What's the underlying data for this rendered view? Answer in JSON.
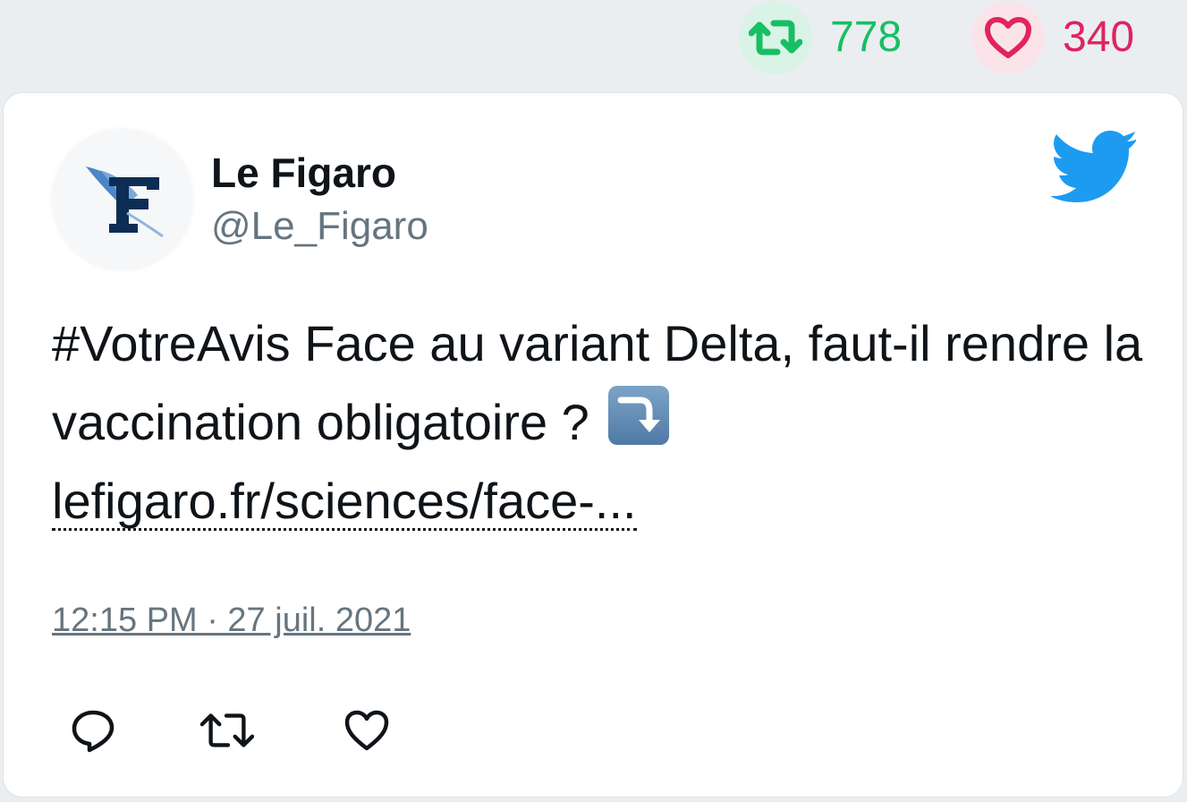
{
  "stats": {
    "retweet_count": "778",
    "like_count": "340",
    "retweet_icon": "retweet-icon",
    "like_icon": "heart-icon"
  },
  "tweet": {
    "author_name": "Le Figaro",
    "author_handle": "@Le_Figaro",
    "avatar_icon": "le-figaro-logo",
    "platform_icon": "twitter-bird-icon",
    "text": "#VotreAvis Face au variant Delta, faut-il rendre la vaccination obligatoire ?",
    "emoji": "arrow-curving-down-emoji",
    "link_text": "lefigaro.fr/sciences/face-...",
    "timestamp": "12:15 PM · 27 juil. 2021"
  },
  "actions": [
    {
      "icon": "reply-icon"
    },
    {
      "icon": "retweet-icon"
    },
    {
      "icon": "like-icon"
    }
  ],
  "colors": {
    "retweet_green": "#17bf63",
    "like_red": "#e0245e",
    "twitter_blue": "#1d9bf0",
    "secondary_text": "#66757f"
  }
}
